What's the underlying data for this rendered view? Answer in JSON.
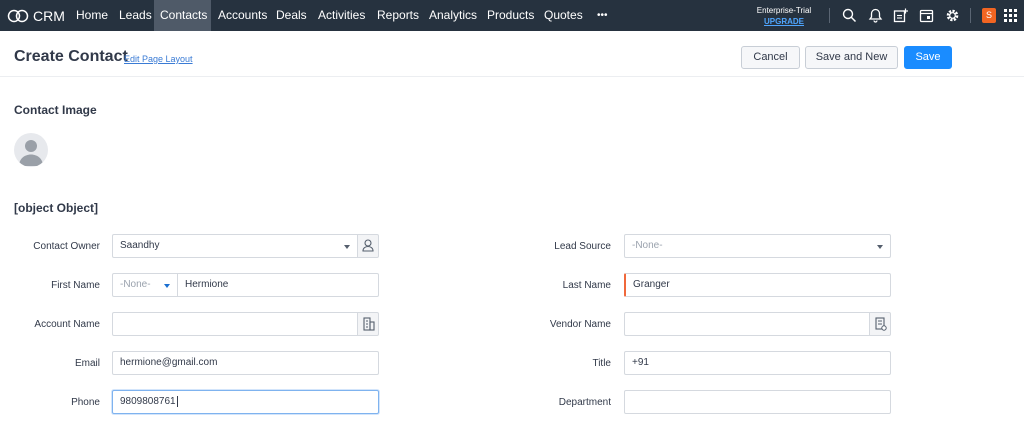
{
  "app": {
    "logo_text": "CRM",
    "nav_tabs": [
      "Home",
      "Leads",
      "Contacts",
      "Accounts",
      "Deals",
      "Activities",
      "Reports",
      "Analytics",
      "Products",
      "Quotes"
    ],
    "active_tab": "Contacts",
    "more_label": "•••",
    "trial_label": "Enterprise-Trial",
    "upgrade_label": "UPGRADE",
    "user_initial": "S",
    "icons": [
      "search-icon",
      "bell-icon",
      "add-note-icon",
      "calendar-icon",
      "settings-icon",
      "apps-grid-icon"
    ],
    "colors": {
      "nav_bg": "#26323f",
      "nav_active": "#4f5a68",
      "primary": "#1a8cff",
      "upgrade": "#4fa6ff",
      "avatar": "#f26522"
    }
  },
  "header": {
    "title": "Create Contact",
    "edit_layout_link": "Edit Page Layout",
    "cancel_label": "Cancel",
    "save_new_label": "Save and New",
    "save_label": "Save"
  },
  "image_section": {
    "title": "Contact Image"
  },
  "info_section": {
    "title": {
      "label": "Title",
      "value": "+91"
    },
    "contact_owner": {
      "label": "Contact Owner",
      "value": "Saandhy"
    },
    "first_name": {
      "label": "First Name",
      "salutation": "-None-",
      "value": "Hermione"
    },
    "account_name": {
      "label": "Account Name",
      "value": ""
    },
    "email": {
      "label": "Email",
      "value": "hermione@gmail.com"
    },
    "phone": {
      "label": "Phone",
      "value": "9809808761"
    },
    "lead_source": {
      "label": "Lead Source",
      "value": "-None-"
    },
    "last_name": {
      "label": "Last Name",
      "value": "Granger"
    },
    "vendor_name": {
      "label": "Vendor Name",
      "value": ""
    },
    "department": {
      "label": "Department",
      "value": ""
    }
  }
}
